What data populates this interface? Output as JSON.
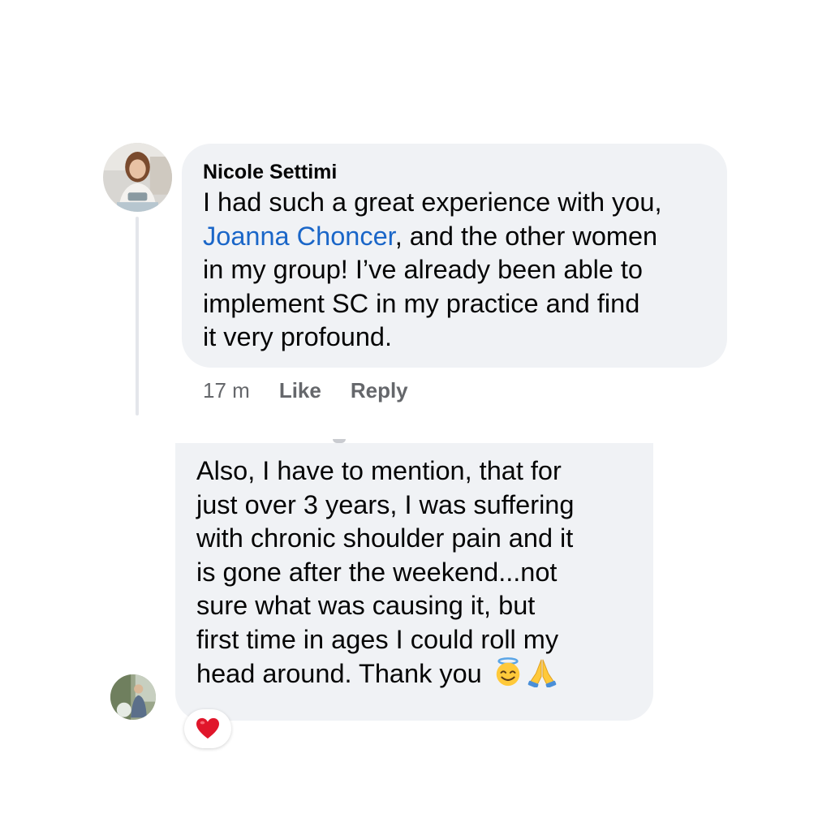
{
  "colors": {
    "bubble_background": "#f0f2f5",
    "mention_link": "#1a66c8",
    "meta_text": "#65676b",
    "heart": "#e0162b"
  },
  "comment_1": {
    "author": "Nicole Settimi",
    "text_before_mention": "I had such a great experience with you,\n",
    "mention": "Joanna Choncer",
    "text_after_mention": ", and the other women\nin my group! I’ve already been able to\nimplement SC in my practice and find\nit very profound.",
    "timestamp": "17 m",
    "like_label": "Like",
    "reply_label": "Reply"
  },
  "comment_2": {
    "text": "Also, I have to mention, that for\njust over 3 years, I was suffering\nwith chronic shoulder pain and it\nis gone after the weekend...not\nsure what was causing it, but\nfirst time in ages I could roll my\nhead around. Thank you ",
    "emojis": [
      "smiling-face-with-halo-icon",
      "folded-hands-icon"
    ],
    "reaction": "red-heart-icon"
  },
  "icons": {
    "avatar_1": "profile-photo-woman",
    "avatar_2": "profile-photo-outdoor"
  }
}
